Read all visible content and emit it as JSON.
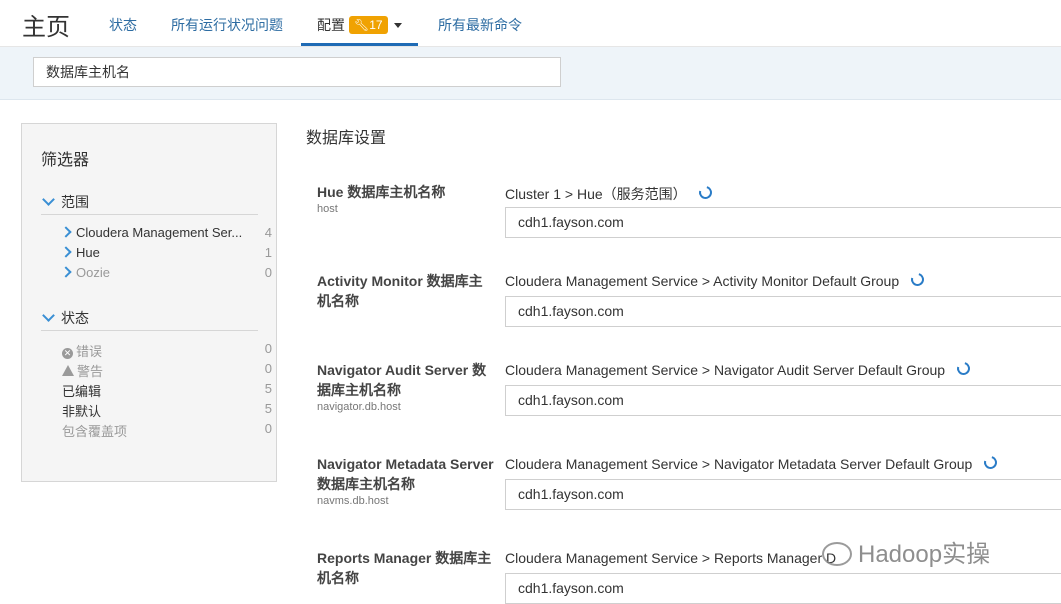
{
  "header": {
    "title": "主页",
    "tabs": [
      {
        "label": "状态"
      },
      {
        "label": "所有运行状况问题"
      },
      {
        "label": "配置",
        "badge": "17"
      },
      {
        "label": "所有最新命令"
      }
    ]
  },
  "search": {
    "value": "数据库主机名"
  },
  "filters": {
    "title": "筛选器",
    "scope": {
      "label": "范围",
      "items": [
        {
          "label": "Cloudera Management Ser...",
          "count": "4"
        },
        {
          "label": "Hue",
          "count": "1"
        },
        {
          "label": "Oozie",
          "count": "0"
        }
      ]
    },
    "status": {
      "label": "状态",
      "items": [
        {
          "label": "错误",
          "count": "0"
        },
        {
          "label": "警告",
          "count": "0"
        },
        {
          "label": "已编辑",
          "count": "5"
        },
        {
          "label": "非默认",
          "count": "5"
        },
        {
          "label": "包含覆盖项",
          "count": "0"
        }
      ]
    }
  },
  "main": {
    "section_title": "数据库设置",
    "properties": [
      {
        "name": "Hue 数据库主机名称",
        "key": "host",
        "scope": "Cluster 1 > Hue（服务范围）",
        "value": "cdh1.fayson.com"
      },
      {
        "name": "Activity Monitor 数据库主机名称",
        "key": "",
        "scope": "Cloudera Management Service > Activity Monitor Default Group",
        "value": "cdh1.fayson.com"
      },
      {
        "name": "Navigator Audit Server 数据库主机名称",
        "key": "navigator.db.host",
        "scope": "Cloudera Management Service > Navigator Audit Server Default Group",
        "value": "cdh1.fayson.com"
      },
      {
        "name": "Navigator Metadata Server 数据库主机名称",
        "key": "navms.db.host",
        "scope": "Cloudera Management Service > Navigator Metadata Server Default Group",
        "value": "cdh1.fayson.com"
      },
      {
        "name": "Reports Manager 数据库主机名称",
        "key": "",
        "scope": "Cloudera Management Service > Reports Manager D",
        "value": "cdh1.fayson.com"
      }
    ]
  },
  "watermark": "Hadoop实操"
}
